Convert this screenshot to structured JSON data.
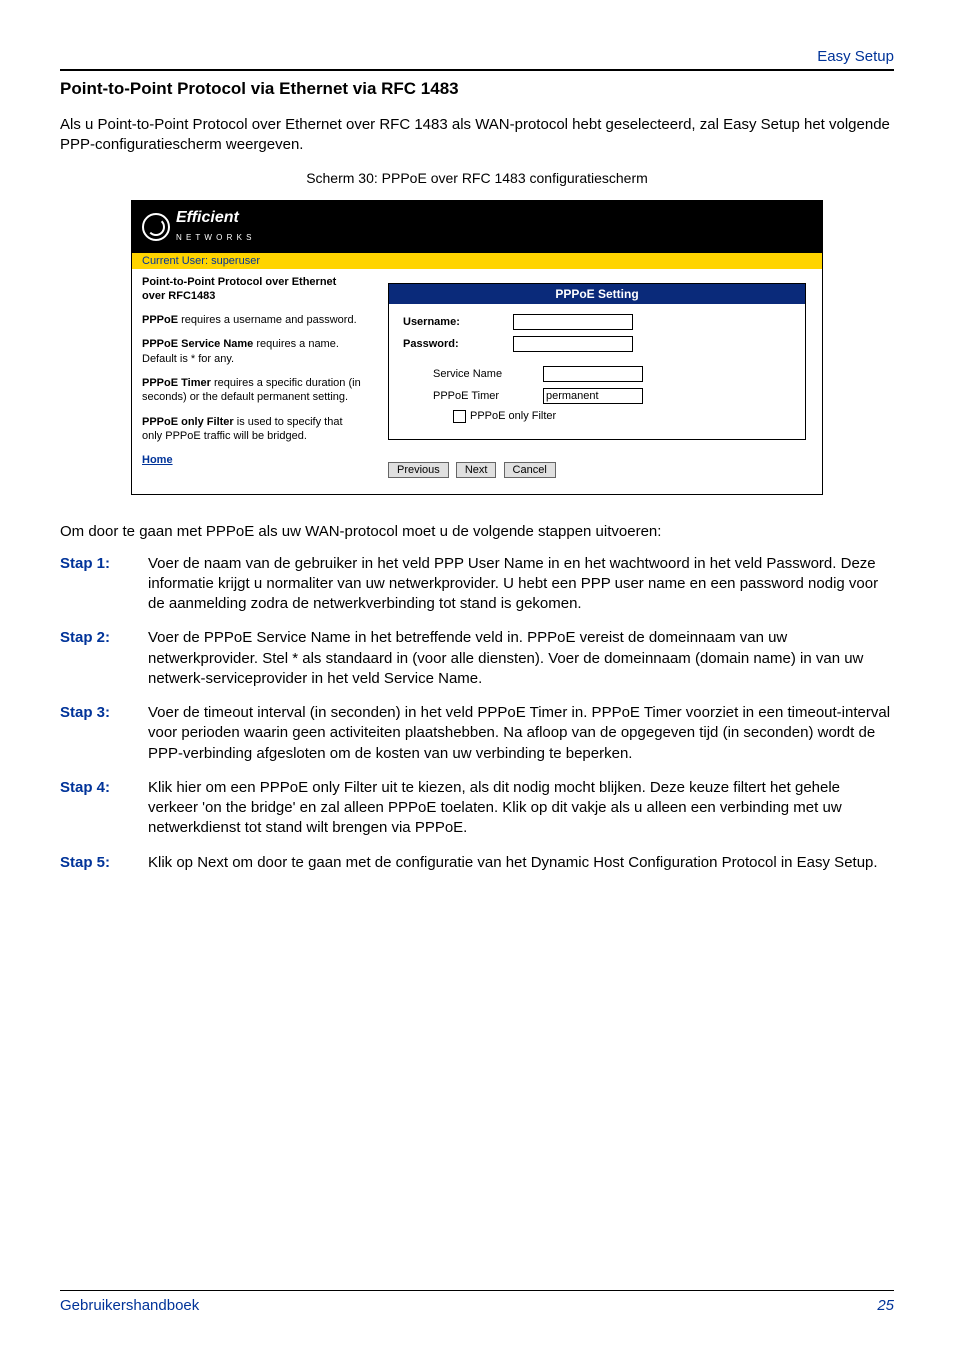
{
  "header": {
    "breadcrumb": "Easy Setup"
  },
  "section": {
    "title": "Point-to-Point Protocol via Ethernet via RFC 1483",
    "intro": "Als u Point-to-Point Protocol over Ethernet over RFC 1483 als WAN-protocol hebt geselecteerd, zal Easy Setup het volgende PPP-configuratiescherm weergeven.",
    "caption": "Scherm 30: PPPoE over RFC 1483 configuratiescherm"
  },
  "figure": {
    "logo_text": "Efficient",
    "logo_sub": "N E T W O R K S",
    "userbar": "Current User: superuser",
    "left_title": "Point-to-Point Protocol over Ethernet over RFC1483",
    "left_p1_b": "PPPoE",
    "left_p1": " requires a username and password.",
    "left_p2_b": "PPPoE Service Name",
    "left_p2": " requires a name. Default is * for any.",
    "left_p3_b": "PPPoE Timer",
    "left_p3": " requires a specific duration (in seconds) or the default permanent setting.",
    "left_p4_b": "PPPoE only Filter",
    "left_p4": " is used to specify that only PPPoE traffic will be bridged.",
    "home": "Home",
    "panel_head": "PPPoE Setting",
    "lbl_user": "Username:",
    "lbl_pass": "Password:",
    "lbl_service": "Service Name",
    "lbl_timer": "PPPoE Timer",
    "timer_value": "permanent",
    "lbl_filter": "PPPoE only Filter",
    "btn_prev": "Previous",
    "btn_next": "Next",
    "btn_cancel": "Cancel"
  },
  "steps_intro": "Om door te gaan met PPPoE als uw WAN-protocol moet u de volgende stappen uitvoeren:",
  "steps": [
    {
      "label": "Stap 1:",
      "text": "Voer de naam van de gebruiker in het veld PPP User Name in en het wachtwoord in het veld Password. Deze informatie krijgt u normaliter van uw netwerkprovider. U hebt een PPP user name en een password nodig voor de aanmelding zodra de netwerkverbinding tot stand is gekomen."
    },
    {
      "label": "Stap 2:",
      "text": "Voer de PPPoE Service Name in het betreffende veld in. PPPoE vereist de domeinnaam van uw netwerkprovider. Stel * als standaard in (voor alle diensten). Voer de domeinnaam (domain name) in van uw netwerk-serviceprovider in het veld Service Name."
    },
    {
      "label": "Stap 3:",
      "text": "Voer de timeout interval (in seconden) in het veld PPPoE Timer in. PPPoE Timer voorziet in een timeout-interval voor perioden waarin geen activiteiten plaatshebben. Na afloop van de opgegeven tijd (in seconden) wordt de PPP-verbinding afgesloten om de kosten van uw verbinding te beperken."
    },
    {
      "label": "Stap 4:",
      "text": "Klik hier om een PPPoE only Filter uit te kiezen, als dit nodig mocht blijken. Deze keuze filtert het gehele verkeer 'on the bridge' en zal alleen PPPoE toelaten. Klik op dit vakje als u alleen een verbinding met uw netwerkdienst tot stand wilt brengen via PPPoE."
    },
    {
      "label": "Stap 5:",
      "text": "Klik op Next om door te gaan met de configuratie van het Dynamic Host Configuration Protocol in Easy Setup."
    }
  ],
  "footer": {
    "left": "Gebruikershandboek",
    "right": "25"
  }
}
